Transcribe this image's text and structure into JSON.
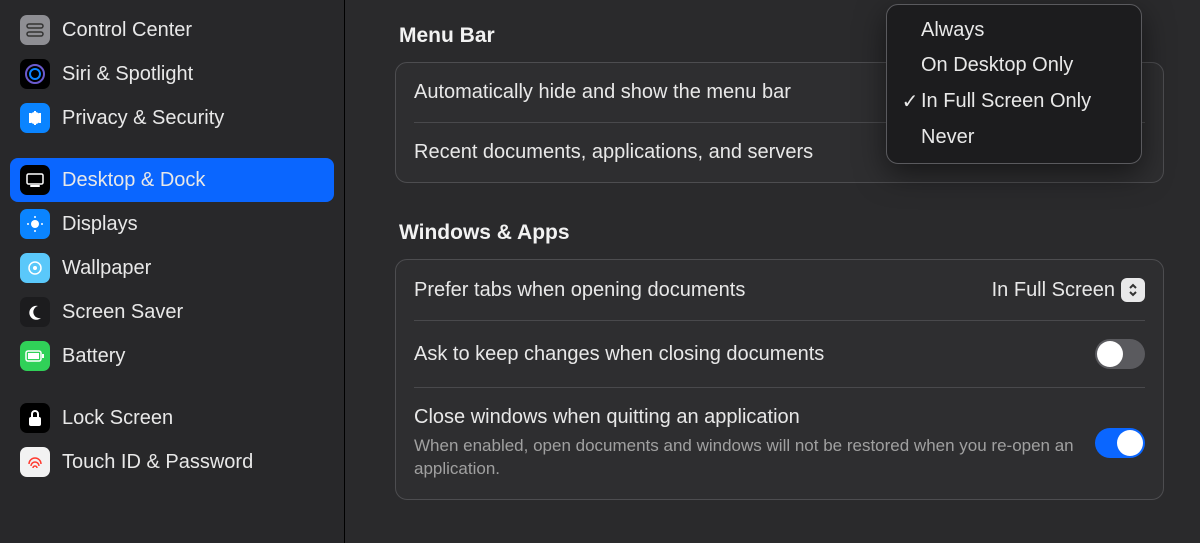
{
  "sidebar": {
    "items": [
      {
        "label": "Control Center"
      },
      {
        "label": "Siri & Spotlight"
      },
      {
        "label": "Privacy & Security"
      },
      {
        "label": "Desktop & Dock"
      },
      {
        "label": "Displays"
      },
      {
        "label": "Wallpaper"
      },
      {
        "label": "Screen Saver"
      },
      {
        "label": "Battery"
      },
      {
        "label": "Lock Screen"
      },
      {
        "label": "Touch ID & Password"
      }
    ]
  },
  "menuBar": {
    "title": "Menu Bar",
    "rows": [
      {
        "label": "Automatically hide and show the menu bar"
      },
      {
        "label": "Recent documents, applications, and servers"
      }
    ],
    "dropdown": {
      "options": [
        "Always",
        "On Desktop Only",
        "In Full Screen Only",
        "Never"
      ],
      "selected": "In Full Screen Only"
    }
  },
  "windowsApps": {
    "title": "Windows & Apps",
    "rows": [
      {
        "label": "Prefer tabs when opening documents",
        "value": "In Full Screen"
      },
      {
        "label": "Ask to keep changes when closing documents",
        "toggle": false
      },
      {
        "label": "Close windows when quitting an application",
        "toggle": true,
        "sub": "When enabled, open documents and windows will not be restored when you re-open an application."
      }
    ]
  }
}
